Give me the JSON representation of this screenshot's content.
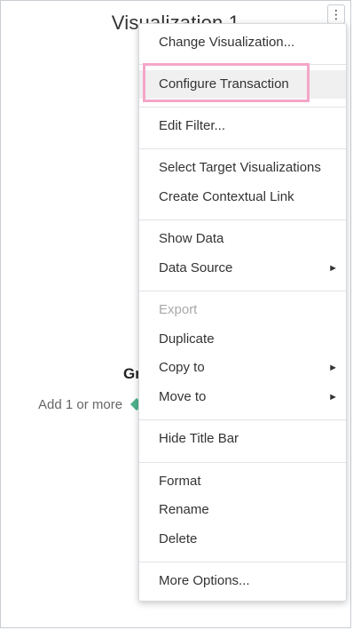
{
  "viz": {
    "title": "Visualization 1",
    "heading": "Gr",
    "hint": "Add 1 or more",
    "kebab": "⋮"
  },
  "menu": {
    "items": [
      {
        "label": "Change Visualization..."
      },
      {
        "label": "Configure Transaction"
      },
      {
        "label": "Edit Filter..."
      },
      {
        "label": "Select Target Visualizations"
      },
      {
        "label": "Create Contextual Link"
      },
      {
        "label": "Show Data"
      },
      {
        "label": "Data Source"
      },
      {
        "label": "Export"
      },
      {
        "label": "Duplicate"
      },
      {
        "label": "Copy to"
      },
      {
        "label": "Move to"
      },
      {
        "label": "Hide Title Bar"
      },
      {
        "label": "Format"
      },
      {
        "label": "Rename"
      },
      {
        "label": "Delete"
      },
      {
        "label": "More Options..."
      }
    ],
    "submenu_arrow": "►",
    "highlight_color": "#f4a6c8"
  }
}
